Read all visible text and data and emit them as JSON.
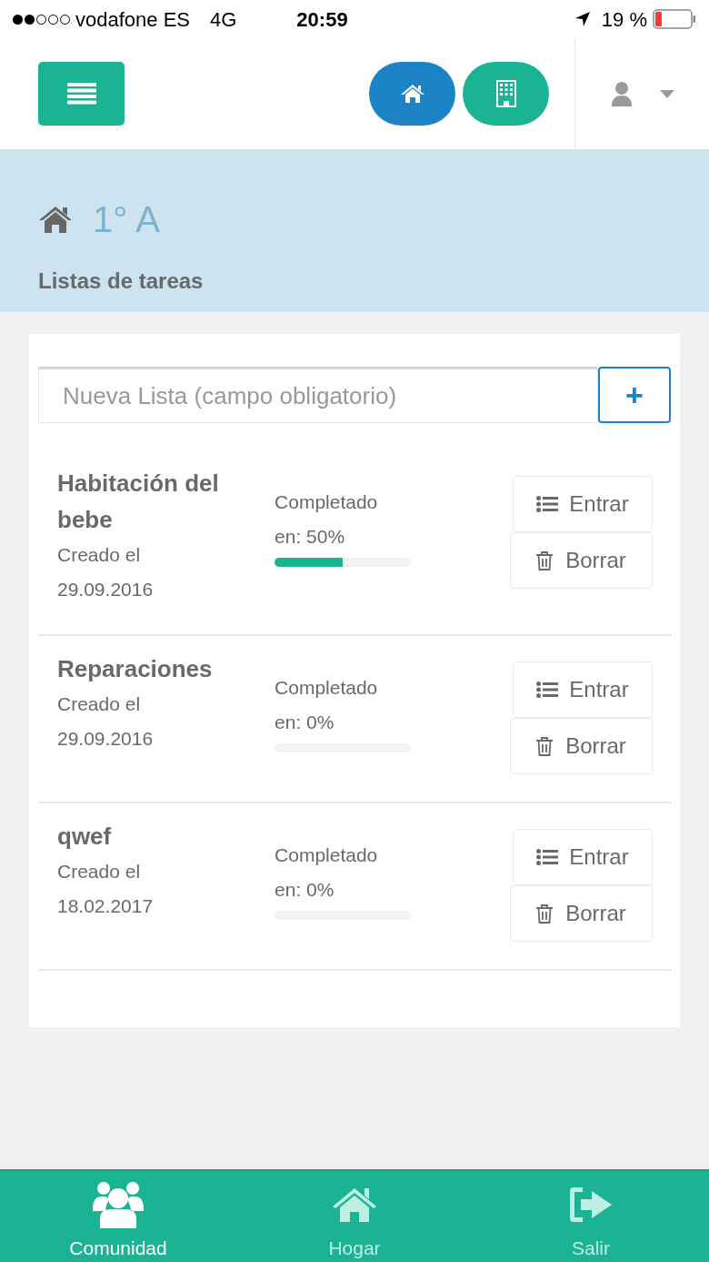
{
  "status_bar": {
    "carrier": "vodafone ES",
    "network": "4G",
    "time": "20:59",
    "battery": "19 %"
  },
  "header": {
    "nav_buttons": [
      {
        "kind": "home",
        "selected": true
      },
      {
        "kind": "building",
        "selected": false
      }
    ]
  },
  "banner": {
    "title": "1° A",
    "subtitle": "Listas de tareas"
  },
  "new_list": {
    "placeholder": "Nueva Lista (campo obligatorio)",
    "add_label": "+"
  },
  "lists": [
    {
      "name": "Habitación del bebe",
      "created": "Creado el 29.09.2016",
      "progress_label": "Completado en: 50%",
      "level": 0.5,
      "enter": "Entrar",
      "delete": "Borrar"
    },
    {
      "name": "Reparaciones",
      "created": "Creado el 29.09.2016",
      "progress_label": "Completado en: 0%",
      "enter": "Entrar",
      "delete": "Borrar"
    },
    {
      "name": "qwef",
      "created": "Creado el 18.02.2017",
      "progress_label": "Completado en: 0%",
      "enter": "Entrar",
      "delete": "Borrar"
    }
  ],
  "bottom_nav": [
    {
      "kind": "community",
      "label": "Comunidad",
      "selected": true
    },
    {
      "kind": "home",
      "label": "Hogar",
      "selected": false
    },
    {
      "kind": "exit",
      "label": "Salir",
      "selected": false
    }
  ]
}
